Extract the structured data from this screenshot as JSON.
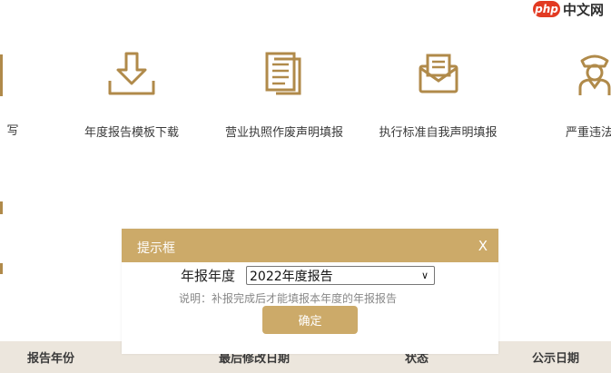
{
  "watermark": {
    "badge": "php",
    "text": "中文网"
  },
  "services": [
    {
      "label": "写",
      "icon": "pen-icon"
    },
    {
      "label": "年度报告模板下载",
      "icon": "download-tray-icon"
    },
    {
      "label": "营业执照作废声明填报",
      "icon": "documents-icon"
    },
    {
      "label": "执行标准自我声明填报",
      "icon": "open-envelope-icon"
    },
    {
      "label": "严重违法",
      "icon": "officer-icon"
    }
  ],
  "table": {
    "headers": [
      "报告年份",
      "最后修改日期",
      "状态",
      "公示日期"
    ]
  },
  "modal": {
    "title": "提示框",
    "close": "X",
    "field_label": "年报年度",
    "selected_year": "2022年度报告",
    "note": "说明：补报完成后才能填报本年度的年报报告",
    "confirm": "确定"
  },
  "colors": {
    "accent": "#ccaa69",
    "header_bg": "#ece6dd",
    "icon": "#b08a4a"
  }
}
